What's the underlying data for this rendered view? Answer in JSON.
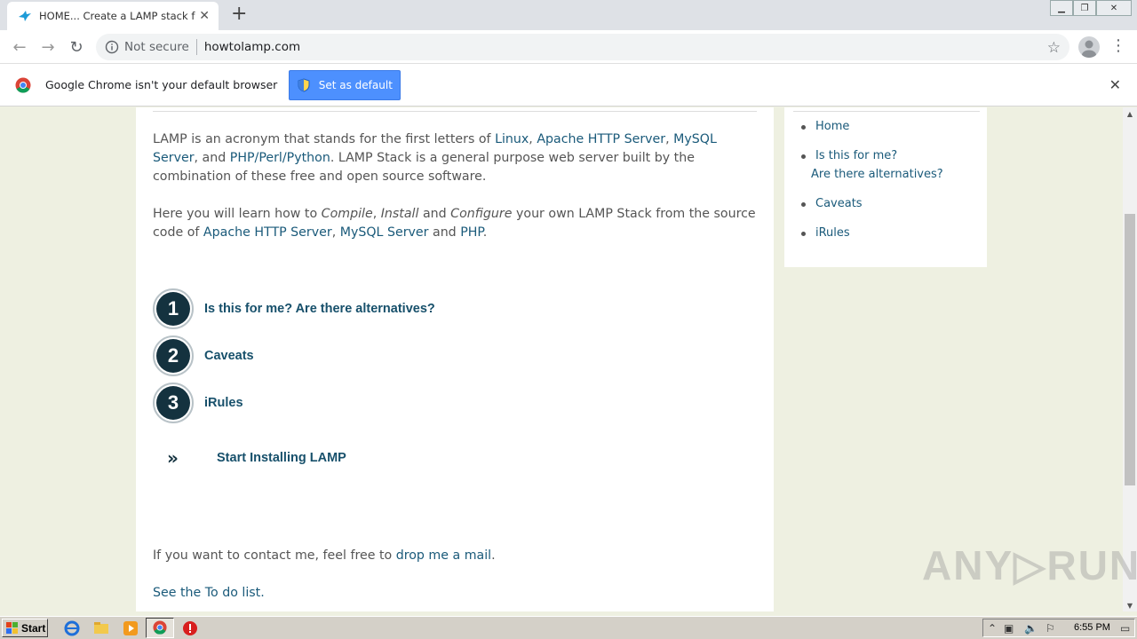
{
  "browser": {
    "tab_title": "HOME... Create a LAMP stack from s",
    "not_secure_label": "Not secure",
    "url": "howtolamp.com",
    "tab_close_glyph": "✕",
    "new_tab_glyph": "+"
  },
  "infobar": {
    "message": "Google Chrome isn't your default browser",
    "button_label": "Set as default",
    "close_glyph": "✕"
  },
  "page": {
    "intro": {
      "t1": "LAMP is an acronym that stands for the first letters of ",
      "link_linux": "Linux",
      "c1": ", ",
      "link_apache": "Apache HTTP Server",
      "c2": ", ",
      "link_mysql": "MySQL Server",
      "c3": ", and ",
      "link_php": "PHP/Perl/Python",
      "t2": ". LAMP Stack is a general purpose web server built by the combination of these free and open source software."
    },
    "learn": {
      "t1": "Here you will learn how to ",
      "compile": "Compile",
      "c1": ", ",
      "install": "Install",
      "and1": " and ",
      "configure": "Configure",
      "t2": " your own LAMP Stack from the source code of ",
      "link_apache": "Apache HTTP Server",
      "c2": ", ",
      "link_mysql": "MySQL Server",
      "and2": " and ",
      "link_php": "PHP",
      "end": "."
    },
    "steps": [
      {
        "number": "1",
        "label": "Is this for me? Are there alternatives?"
      },
      {
        "number": "2",
        "label": "Caveats"
      },
      {
        "number": "3",
        "label": "iRules"
      }
    ],
    "start_label": "Start Installing LAMP",
    "start_glyph": "»",
    "contact": {
      "t1": "If you want to contact me, feel free to ",
      "link": "drop me a mail",
      "end": "."
    },
    "todo": "See the To do list."
  },
  "sidebar": {
    "items": [
      {
        "line1": "Home"
      },
      {
        "line1": "Is this for me?",
        "line2": "Are there alternatives?"
      },
      {
        "line1": "Caveats"
      },
      {
        "line1": "iRules"
      }
    ]
  },
  "watermark": "ANY▷RUN",
  "taskbar": {
    "start_label": "Start",
    "clock": "6:55 PM"
  },
  "colors": {
    "link": "#1a5a7a",
    "badge": "#14323f",
    "page_bg": "#eef0e1",
    "infobar_button": "#4d90fe"
  }
}
